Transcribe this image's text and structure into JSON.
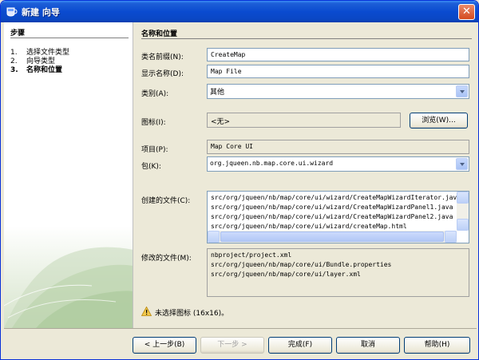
{
  "window": {
    "title": "新建 向导"
  },
  "steps": {
    "heading": "步骤",
    "items": [
      {
        "num": "1.",
        "label": "选择文件类型"
      },
      {
        "num": "2.",
        "label": "向导类型"
      },
      {
        "num": "3.",
        "label": "名称和位置"
      }
    ]
  },
  "content": {
    "heading": "名称和位置",
    "class_name_prefix": {
      "label": "类名前缀(N):",
      "value": "CreateMap"
    },
    "display_name": {
      "label": "显示名称(D):",
      "value": "Map File"
    },
    "category": {
      "label": "类别(A):",
      "value": "其他"
    },
    "icon": {
      "label": "图标(I):",
      "value": "<无>",
      "browse_label": "浏览(W)..."
    },
    "project": {
      "label": "项目(P):",
      "value": "Map Core UI"
    },
    "package": {
      "label": "包(K):",
      "value": "org.jqueen.nb.map.core.ui.wizard"
    },
    "created_files": {
      "label": "创建的文件(C):",
      "lines": [
        "src/org/jqueen/nb/map/core/ui/wizard/CreateMapWizardIterator.java",
        "src/org/jqueen/nb/map/core/ui/wizard/CreateMapWizardPanel1.java",
        "src/org/jqueen/nb/map/core/ui/wizard/CreateMapWizardPanel2.java",
        "src/org/jqueen/nb/map/core/ui/wizard/createMap.html"
      ]
    },
    "modified_files": {
      "label": "修改的文件(M):",
      "lines": [
        "nbproject/project.xml",
        "src/org/jqueen/nb/map/core/ui/Bundle.properties",
        "src/org/jqueen/nb/map/core/ui/layer.xml"
      ]
    },
    "warning": "未选择图标 (16x16)。"
  },
  "buttons": {
    "back": "< 上一步(B)",
    "next": "下一步 >",
    "finish": "完成(F)",
    "cancel": "取消",
    "help": "帮助(H)"
  },
  "colors": {
    "title_bar": "#0a4bd0",
    "warning": "#f2c94c"
  }
}
